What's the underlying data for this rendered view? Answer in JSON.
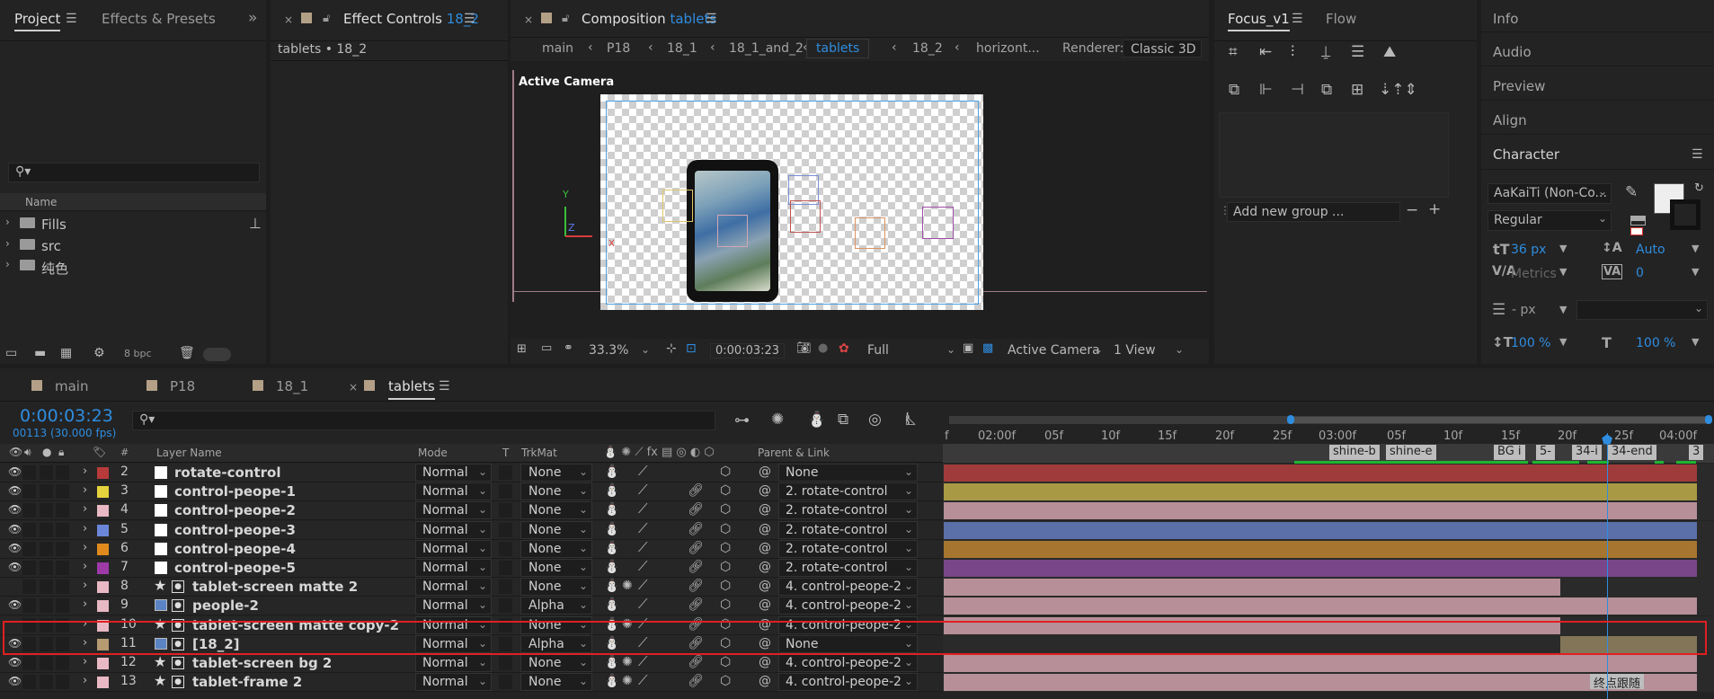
{
  "project_panel": {
    "tabs": [
      "Project",
      "Effects & Presets"
    ],
    "more_glyph": "»",
    "name_header": "Name",
    "items": [
      "Fills",
      "src",
      "纯色"
    ],
    "bpc": "8 bpc"
  },
  "effect_controls": {
    "tab_label": "Effect Controls",
    "tab_target": "18_2",
    "subtitle": "tablets • 18_2"
  },
  "composition": {
    "tab_label": "Composition",
    "tab_target": "tablets",
    "breadcrumbs": [
      "main",
      "P18",
      "18_1",
      "18_1_and_2",
      "tablets",
      "18_2",
      "horizont..."
    ],
    "renderer_label": "Renderer:",
    "renderer_value": "Classic 3D",
    "viewer_label": "Active Camera",
    "axis_y": "Y",
    "axis_z": "Z",
    "axis_x": "X",
    "zoom": "33.3%",
    "timecode": "0:00:03:23",
    "resolution": "Full",
    "camera": "Active Camera",
    "views": "1 View"
  },
  "focus_panel": {
    "tabs": [
      "Focus_v1",
      "Flow"
    ],
    "add_group_placeholder": "Add new group ..."
  },
  "right_panel": {
    "items": [
      "Info",
      "Audio",
      "Preview",
      "Align"
    ],
    "character": {
      "title": "Character",
      "font": "AaKaiTi (Non-Co...",
      "style": "Regular",
      "size": "36 px",
      "leading": "Auto",
      "kerning": "Metrics",
      "tracking": "0",
      "stroke": "- px",
      "vscale": "100 %",
      "hscale": "100 %"
    }
  },
  "timeline": {
    "tabs": [
      "main",
      "P18",
      "18_1",
      "tablets"
    ],
    "timecode": "0:00:03:23",
    "frames": "00113 (30.000 fps)",
    "columns": {
      "layer_name": "Layer Name",
      "mode": "Mode",
      "t": "T",
      "trkmat": "TrkMat",
      "parent": "Parent & Link",
      "num": "#"
    },
    "ruler": [
      "f",
      "02:00f",
      "05f",
      "10f",
      "15f",
      "20f",
      "25f",
      "03:00f",
      "05f",
      "10f",
      "15f",
      "20f",
      "25f",
      "04:00f"
    ],
    "markers": [
      "shine-b",
      "shine-e",
      "BG i",
      "5-",
      "34-i",
      "34-end",
      "3"
    ],
    "comment_marker": "终点跟随",
    "layers": [
      {
        "num": "2",
        "name": "rotate-control",
        "mode": "Normal",
        "trkmat": "None",
        "parent": "None",
        "color": "#b83a3a",
        "bar": "#a03b3b",
        "type": "solid"
      },
      {
        "num": "3",
        "name": "control-peope-1",
        "mode": "Normal",
        "trkmat": "None",
        "parent": "2. rotate-control",
        "color": "#e6d23c",
        "bar": "#a89a44",
        "type": "solid"
      },
      {
        "num": "4",
        "name": "control-peope-2",
        "mode": "Normal",
        "trkmat": "None",
        "parent": "2. rotate-control",
        "color": "#e8b8c4",
        "bar": "#b78f98",
        "type": "solid"
      },
      {
        "num": "5",
        "name": "control-peope-3",
        "mode": "Normal",
        "trkmat": "None",
        "parent": "2. rotate-control",
        "color": "#6b86d8",
        "bar": "#5b6fa8",
        "type": "solid"
      },
      {
        "num": "6",
        "name": "control-peope-4",
        "mode": "Normal",
        "trkmat": "None",
        "parent": "2. rotate-control",
        "color": "#e08a1e",
        "bar": "#a67630",
        "type": "solid"
      },
      {
        "num": "7",
        "name": "control-peope-5",
        "mode": "Normal",
        "trkmat": "None",
        "parent": "2. rotate-control",
        "color": "#9d3aa8",
        "bar": "#79468a",
        "type": "solid"
      },
      {
        "num": "8",
        "name": "tablet-screen matte 2",
        "mode": "Normal",
        "trkmat": "None",
        "parent": "4. control-peope-2",
        "color": "#e8b8c4",
        "bar": "#b78f98",
        "type": "star"
      },
      {
        "num": "9",
        "name": "people-2",
        "mode": "Normal",
        "trkmat": "Alpha",
        "parent": "4. control-peope-2",
        "color": "#e8b8c4",
        "bar": "#b78f98",
        "type": "comp"
      },
      {
        "num": "10",
        "name": "tablet-screen matte copy-2",
        "mode": "Normal",
        "trkmat": "None",
        "parent": "4. control-peope-2",
        "color": "#e8b8c4",
        "bar": "#b78f98",
        "type": "star"
      },
      {
        "num": "11",
        "name": "[18_2]",
        "mode": "Normal",
        "trkmat": "Alpha",
        "parent": "None",
        "color": "#b59a72",
        "bar": "#837658",
        "type": "comp"
      },
      {
        "num": "12",
        "name": "tablet-screen bg 2",
        "mode": "Normal",
        "trkmat": "None",
        "parent": "4. control-peope-2",
        "color": "#e8b8c4",
        "bar": "#b78f98",
        "type": "star"
      },
      {
        "num": "13",
        "name": "tablet-frame 2",
        "mode": "Normal",
        "trkmat": "None",
        "parent": "4. control-peope-2",
        "color": "#e8b8c4",
        "bar": "#b78f98",
        "type": "star"
      }
    ]
  }
}
